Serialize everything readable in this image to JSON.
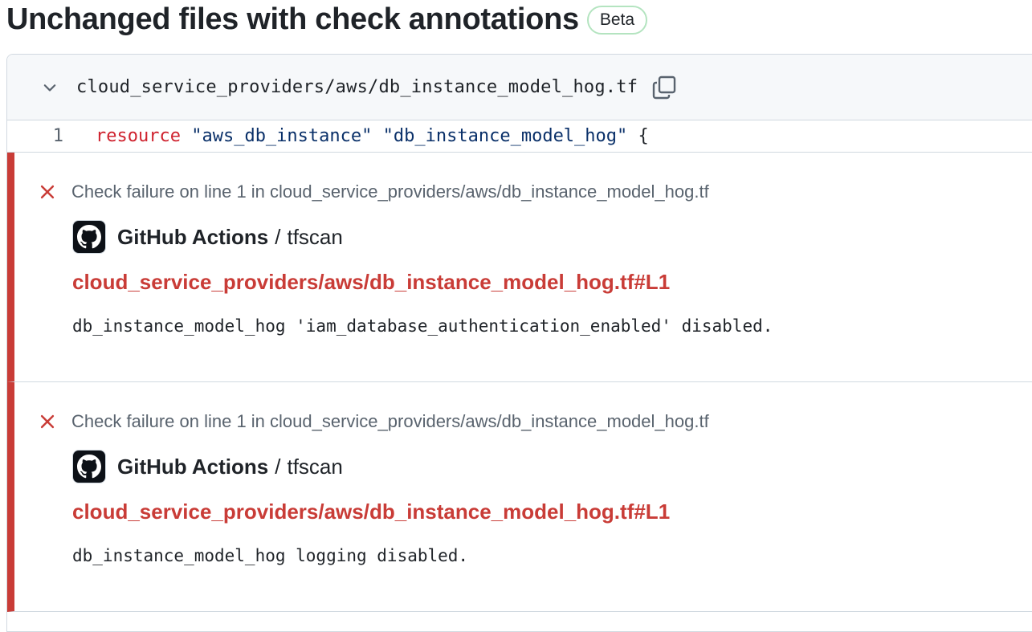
{
  "header": {
    "title": "Unchanged files with check annotations",
    "badge": "Beta"
  },
  "file": {
    "path": "cloud_service_providers/aws/db_instance_model_hog.tf",
    "line_number": "1",
    "code": {
      "keyword": "resource",
      "arg1": "\"aws_db_instance\"",
      "arg2": "\"db_instance_model_hog\"",
      "brace": "{"
    }
  },
  "annotations": [
    {
      "title": "Check failure on line 1 in cloud_service_providers/aws/db_instance_model_hog.tf",
      "source_name": "GitHub Actions",
      "separator": "/",
      "job": "tfscan",
      "link": "cloud_service_providers/aws/db_instance_model_hog.tf#L1",
      "message": "db_instance_model_hog 'iam_database_authentication_enabled' disabled."
    },
    {
      "title": "Check failure on line 1 in cloud_service_providers/aws/db_instance_model_hog.tf",
      "source_name": "GitHub Actions",
      "separator": "/",
      "job": "tfscan",
      "link": "cloud_service_providers/aws/db_instance_model_hog.tf#L1",
      "message": "db_instance_model_hog logging disabled."
    }
  ],
  "colors": {
    "failure": "#c93c37",
    "badge_border": "#b4e4c0"
  },
  "icons": {
    "chevron": "chevron-down-icon",
    "copy": "copy-icon",
    "failure": "x-icon",
    "avatar": "github-mark-icon"
  }
}
